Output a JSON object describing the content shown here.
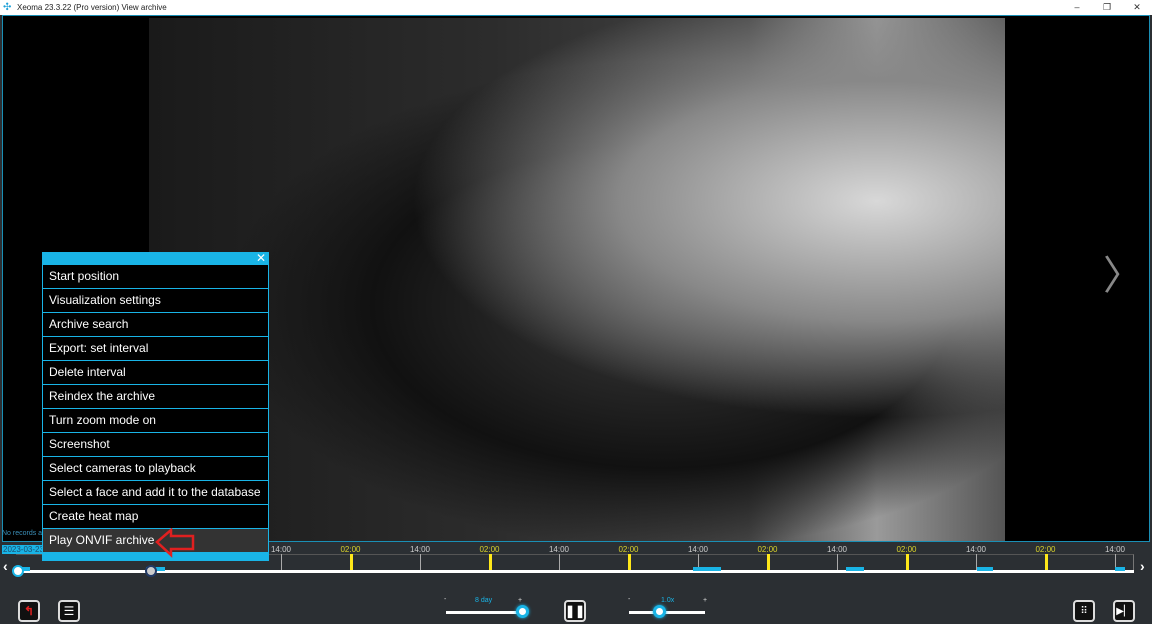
{
  "window": {
    "title": "Xeoma 23.3.22 (Pro version) View archive",
    "controls": [
      "–",
      "❐",
      "✕"
    ]
  },
  "status": {
    "no_records": "No records a"
  },
  "timeline": {
    "date": "2023-03-23",
    "labels": [
      {
        "t": "14:00",
        "y": false
      },
      {
        "t": "02:00",
        "y": true
      },
      {
        "t": "14:00",
        "y": false
      },
      {
        "t": "02:00",
        "y": true
      },
      {
        "t": "14:00",
        "y": false
      },
      {
        "t": "02:00",
        "y": true
      },
      {
        "t": "14:00",
        "y": false
      },
      {
        "t": "02:00",
        "y": true
      },
      {
        "t": "14:00",
        "y": false
      },
      {
        "t": "02:00",
        "y": true
      },
      {
        "t": "14:00",
        "y": false
      },
      {
        "t": "02:00",
        "y": true
      },
      {
        "t": "14:00",
        "y": false
      }
    ],
    "prev": "‹",
    "next": "›"
  },
  "controls": {
    "range_label": "8 day",
    "speed_label": "1.0x",
    "minus": "-",
    "plus": "+",
    "range_level": 1.0,
    "speed_level": 0.4
  },
  "menu": {
    "close": "✕",
    "items": [
      "Start position",
      "Visualization settings",
      "Archive search",
      "Export: set interval",
      "Delete interval",
      "Reindex the archive",
      "Turn zoom mode on",
      "Screenshot",
      "Select cameras to playback",
      "Select a face and add it to the database",
      "Create heat map",
      "Play ONVIF archive"
    ],
    "highlighted": 11
  },
  "colors": {
    "accent": "#19b4e6",
    "marker": "#ffe81a",
    "annotation": "#e02020"
  }
}
